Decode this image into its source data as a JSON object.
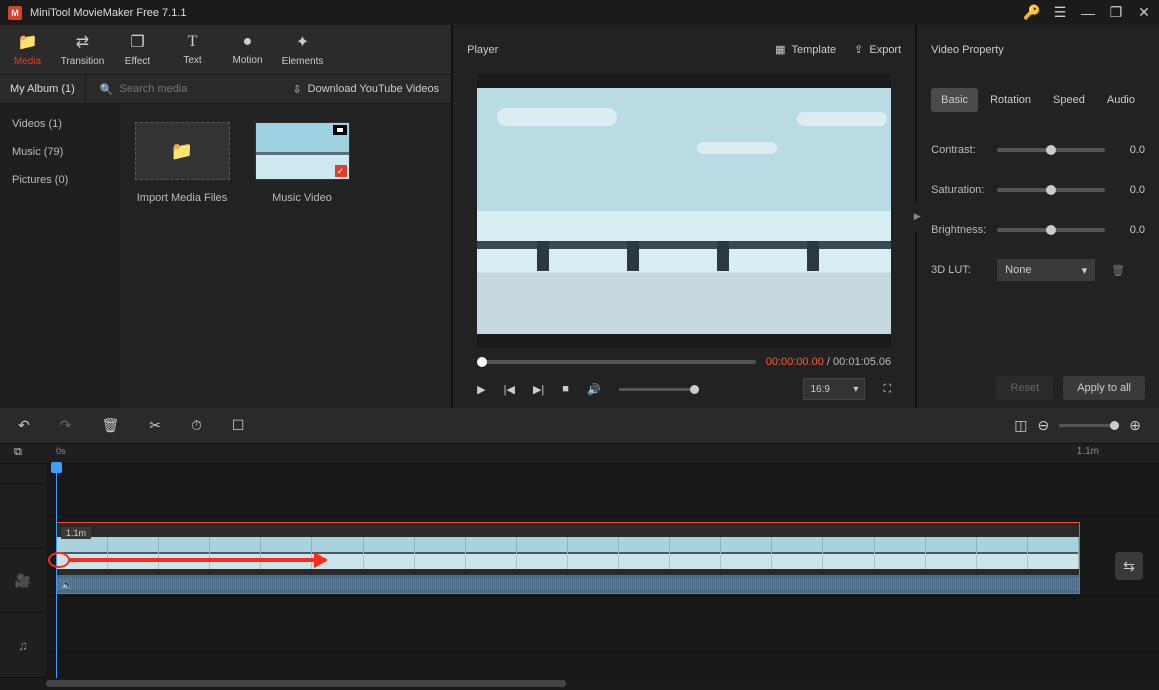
{
  "titlebar": {
    "title": "MiniTool MovieMaker Free 7.1.1"
  },
  "toolTabs": [
    {
      "label": "Media",
      "icon": "📁",
      "active": true
    },
    {
      "label": "Transition",
      "icon": "⇄"
    },
    {
      "label": "Effect",
      "icon": "❐"
    },
    {
      "label": "Text",
      "icon": "T"
    },
    {
      "label": "Motion",
      "icon": "●"
    },
    {
      "label": "Elements",
      "icon": "✦"
    }
  ],
  "subbar": {
    "album": "My Album (1)",
    "searchPlaceholder": "Search media",
    "download": "Download YouTube Videos"
  },
  "sidebar": {
    "items": [
      {
        "label": "Videos (1)"
      },
      {
        "label": "Music (79)"
      },
      {
        "label": "Pictures (0)"
      }
    ]
  },
  "mediaTiles": {
    "import": "Import Media Files",
    "video": "Music Video"
  },
  "player": {
    "header": "Player",
    "templateLabel": "Template",
    "exportLabel": "Export",
    "current": "00:00:00.00",
    "sep": " / ",
    "duration": "00:01:05.06",
    "aspect": "16:9"
  },
  "videoProperty": {
    "header": "Video Property",
    "tabs": {
      "basic": "Basic",
      "rotation": "Rotation",
      "speed": "Speed",
      "audio": "Audio"
    },
    "rows": {
      "contrastLabel": "Contrast:",
      "contrastVal": "0.0",
      "saturationLabel": "Saturation:",
      "saturationVal": "0.0",
      "brightnessLabel": "Brightness:",
      "brightnessVal": "0.0",
      "lutLabel": "3D LUT:",
      "lutValue": "None"
    },
    "reset": "Reset",
    "applyAll": "Apply to all"
  },
  "timeline": {
    "tick0": "0s",
    "totalDur": "1.1m",
    "clipDur": "1.1m"
  }
}
